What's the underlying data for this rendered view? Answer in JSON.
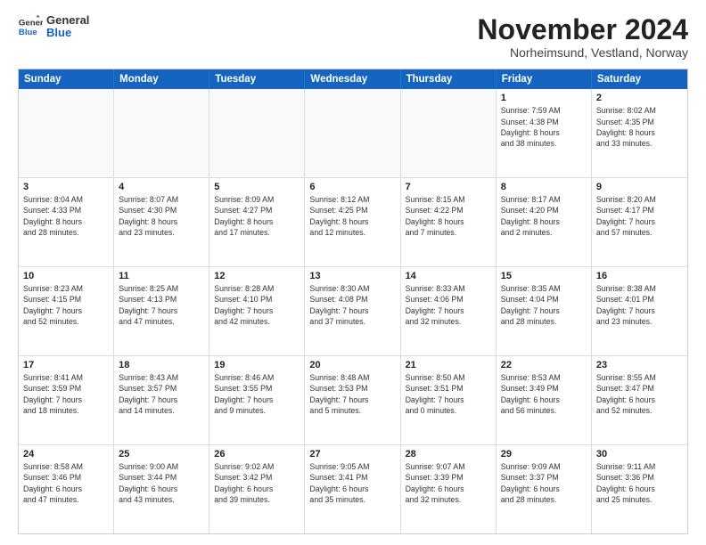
{
  "header": {
    "logo": {
      "general": "General",
      "blue": "Blue"
    },
    "month_year": "November 2024",
    "location": "Norheimsund, Vestland, Norway"
  },
  "weekdays": [
    "Sunday",
    "Monday",
    "Tuesday",
    "Wednesday",
    "Thursday",
    "Friday",
    "Saturday"
  ],
  "weeks": [
    [
      {
        "day": "",
        "lines": []
      },
      {
        "day": "",
        "lines": []
      },
      {
        "day": "",
        "lines": []
      },
      {
        "day": "",
        "lines": []
      },
      {
        "day": "",
        "lines": []
      },
      {
        "day": "1",
        "lines": [
          "Sunrise: 7:59 AM",
          "Sunset: 4:38 PM",
          "Daylight: 8 hours",
          "and 38 minutes."
        ]
      },
      {
        "day": "2",
        "lines": [
          "Sunrise: 8:02 AM",
          "Sunset: 4:35 PM",
          "Daylight: 8 hours",
          "and 33 minutes."
        ]
      }
    ],
    [
      {
        "day": "3",
        "lines": [
          "Sunrise: 8:04 AM",
          "Sunset: 4:33 PM",
          "Daylight: 8 hours",
          "and 28 minutes."
        ]
      },
      {
        "day": "4",
        "lines": [
          "Sunrise: 8:07 AM",
          "Sunset: 4:30 PM",
          "Daylight: 8 hours",
          "and 23 minutes."
        ]
      },
      {
        "day": "5",
        "lines": [
          "Sunrise: 8:09 AM",
          "Sunset: 4:27 PM",
          "Daylight: 8 hours",
          "and 17 minutes."
        ]
      },
      {
        "day": "6",
        "lines": [
          "Sunrise: 8:12 AM",
          "Sunset: 4:25 PM",
          "Daylight: 8 hours",
          "and 12 minutes."
        ]
      },
      {
        "day": "7",
        "lines": [
          "Sunrise: 8:15 AM",
          "Sunset: 4:22 PM",
          "Daylight: 8 hours",
          "and 7 minutes."
        ]
      },
      {
        "day": "8",
        "lines": [
          "Sunrise: 8:17 AM",
          "Sunset: 4:20 PM",
          "Daylight: 8 hours",
          "and 2 minutes."
        ]
      },
      {
        "day": "9",
        "lines": [
          "Sunrise: 8:20 AM",
          "Sunset: 4:17 PM",
          "Daylight: 7 hours",
          "and 57 minutes."
        ]
      }
    ],
    [
      {
        "day": "10",
        "lines": [
          "Sunrise: 8:23 AM",
          "Sunset: 4:15 PM",
          "Daylight: 7 hours",
          "and 52 minutes."
        ]
      },
      {
        "day": "11",
        "lines": [
          "Sunrise: 8:25 AM",
          "Sunset: 4:13 PM",
          "Daylight: 7 hours",
          "and 47 minutes."
        ]
      },
      {
        "day": "12",
        "lines": [
          "Sunrise: 8:28 AM",
          "Sunset: 4:10 PM",
          "Daylight: 7 hours",
          "and 42 minutes."
        ]
      },
      {
        "day": "13",
        "lines": [
          "Sunrise: 8:30 AM",
          "Sunset: 4:08 PM",
          "Daylight: 7 hours",
          "and 37 minutes."
        ]
      },
      {
        "day": "14",
        "lines": [
          "Sunrise: 8:33 AM",
          "Sunset: 4:06 PM",
          "Daylight: 7 hours",
          "and 32 minutes."
        ]
      },
      {
        "day": "15",
        "lines": [
          "Sunrise: 8:35 AM",
          "Sunset: 4:04 PM",
          "Daylight: 7 hours",
          "and 28 minutes."
        ]
      },
      {
        "day": "16",
        "lines": [
          "Sunrise: 8:38 AM",
          "Sunset: 4:01 PM",
          "Daylight: 7 hours",
          "and 23 minutes."
        ]
      }
    ],
    [
      {
        "day": "17",
        "lines": [
          "Sunrise: 8:41 AM",
          "Sunset: 3:59 PM",
          "Daylight: 7 hours",
          "and 18 minutes."
        ]
      },
      {
        "day": "18",
        "lines": [
          "Sunrise: 8:43 AM",
          "Sunset: 3:57 PM",
          "Daylight: 7 hours",
          "and 14 minutes."
        ]
      },
      {
        "day": "19",
        "lines": [
          "Sunrise: 8:46 AM",
          "Sunset: 3:55 PM",
          "Daylight: 7 hours",
          "and 9 minutes."
        ]
      },
      {
        "day": "20",
        "lines": [
          "Sunrise: 8:48 AM",
          "Sunset: 3:53 PM",
          "Daylight: 7 hours",
          "and 5 minutes."
        ]
      },
      {
        "day": "21",
        "lines": [
          "Sunrise: 8:50 AM",
          "Sunset: 3:51 PM",
          "Daylight: 7 hours",
          "and 0 minutes."
        ]
      },
      {
        "day": "22",
        "lines": [
          "Sunrise: 8:53 AM",
          "Sunset: 3:49 PM",
          "Daylight: 6 hours",
          "and 56 minutes."
        ]
      },
      {
        "day": "23",
        "lines": [
          "Sunrise: 8:55 AM",
          "Sunset: 3:47 PM",
          "Daylight: 6 hours",
          "and 52 minutes."
        ]
      }
    ],
    [
      {
        "day": "24",
        "lines": [
          "Sunrise: 8:58 AM",
          "Sunset: 3:46 PM",
          "Daylight: 6 hours",
          "and 47 minutes."
        ]
      },
      {
        "day": "25",
        "lines": [
          "Sunrise: 9:00 AM",
          "Sunset: 3:44 PM",
          "Daylight: 6 hours",
          "and 43 minutes."
        ]
      },
      {
        "day": "26",
        "lines": [
          "Sunrise: 9:02 AM",
          "Sunset: 3:42 PM",
          "Daylight: 6 hours",
          "and 39 minutes."
        ]
      },
      {
        "day": "27",
        "lines": [
          "Sunrise: 9:05 AM",
          "Sunset: 3:41 PM",
          "Daylight: 6 hours",
          "and 35 minutes."
        ]
      },
      {
        "day": "28",
        "lines": [
          "Sunrise: 9:07 AM",
          "Sunset: 3:39 PM",
          "Daylight: 6 hours",
          "and 32 minutes."
        ]
      },
      {
        "day": "29",
        "lines": [
          "Sunrise: 9:09 AM",
          "Sunset: 3:37 PM",
          "Daylight: 6 hours",
          "and 28 minutes."
        ]
      },
      {
        "day": "30",
        "lines": [
          "Sunrise: 9:11 AM",
          "Sunset: 3:36 PM",
          "Daylight: 6 hours",
          "and 25 minutes."
        ]
      }
    ]
  ]
}
